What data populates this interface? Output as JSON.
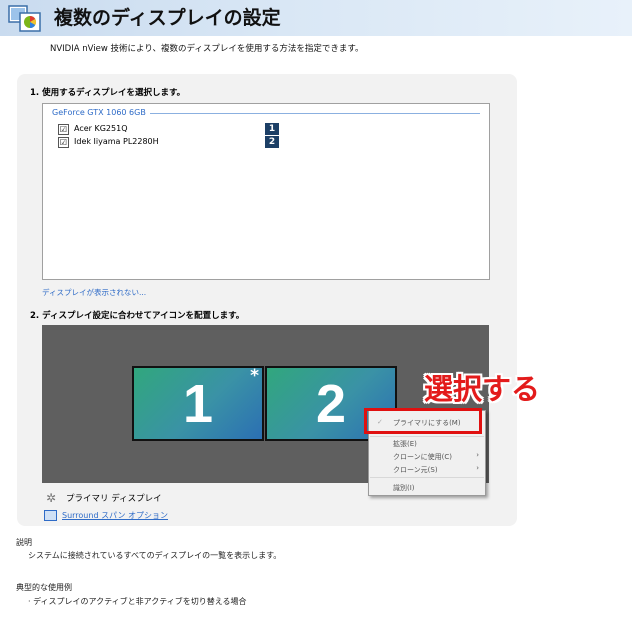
{
  "header": {
    "title": "複数のディスプレイの設定",
    "subtitle": "NVIDIA nView 技術により、複数のディスプレイを使用する方法を指定できます。"
  },
  "section1": {
    "title": "1. 使用するディスプレイを選択します。",
    "gpu_label": "GeForce GTX 1060 6GB",
    "displays": [
      {
        "name": "Acer KG251Q",
        "number": "1",
        "checked": "☑"
      },
      {
        "name": "Idek Iiyama PL2280H",
        "number": "2",
        "checked": "☑"
      }
    ],
    "link": "ディスプレイが表示されない..."
  },
  "section2": {
    "title": "2. ディスプレイ設定に合わせてアイコンを配置します。",
    "monitors": [
      {
        "number": "1",
        "star": "*"
      },
      {
        "number": "2"
      }
    ],
    "primary_legend": "プライマリ ディスプレイ",
    "surround_link": "Surround スパン オプション"
  },
  "context_menu": {
    "items": [
      {
        "label": "プライマリにする(M)",
        "check": "✓"
      },
      {
        "label": "拡張(E)"
      },
      {
        "label": "クローンに使用(C)",
        "arrow": "›"
      },
      {
        "label": "クローン元(S)",
        "arrow": "›"
      },
      {
        "label": "識別(I)"
      }
    ]
  },
  "annotation": {
    "text": "選択する",
    "color": "#e31b1b"
  },
  "description": {
    "title": "説明",
    "text": "システムに接続されているすべてのディスプレイの一覧を表示します。"
  },
  "usage": {
    "title": "典型的な使用例",
    "text": "· ディスプレイのアクティブと非アクティブを切り替える場合"
  },
  "icons": {
    "header": "multi-display-icon",
    "primary": "star-icon",
    "surround": "surround-display-icon"
  }
}
